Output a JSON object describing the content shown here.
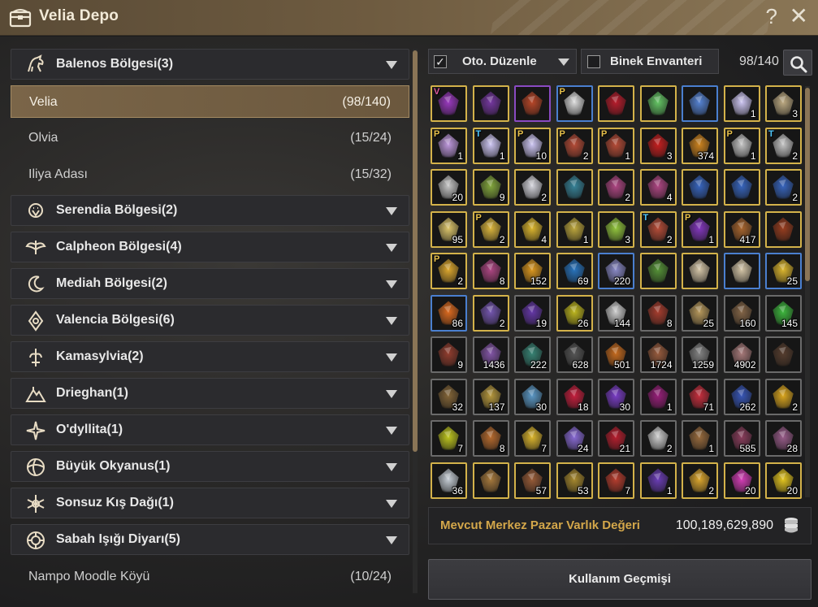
{
  "window": {
    "title": "Velia Depo",
    "help_label": "?",
    "close_label": "✕"
  },
  "regions": [
    {
      "label": "Balenos Bölgesi(3)",
      "icon": "horse-icon",
      "expanded": true
    },
    {
      "label": "Serendia Bölgesi(2)",
      "icon": "lion-icon"
    },
    {
      "label": "Calpheon Bölgesi(4)",
      "icon": "eagle-icon"
    },
    {
      "label": "Mediah Bölgesi(2)",
      "icon": "moon-icon"
    },
    {
      "label": "Valencia Bölgesi(6)",
      "icon": "sun-diamond-icon"
    },
    {
      "label": "Kamasylvia(2)",
      "icon": "tree-spirit-icon"
    },
    {
      "label": "Drieghan(1)",
      "icon": "mountain-icon"
    },
    {
      "label": "O'dyllita(1)",
      "icon": "star-icon"
    },
    {
      "label": "Büyük Okyanus(1)",
      "icon": "globe-icon"
    },
    {
      "label": "Sonsuz Kış Dağı(1)",
      "icon": "snowflake-icon"
    },
    {
      "label": "Sabah Işığı Diyarı(5)",
      "icon": "dawn-emblem-icon"
    }
  ],
  "towns": [
    {
      "name": "Velia",
      "count": "(98/140)",
      "selected": true
    },
    {
      "name": "Olvia",
      "count": "(15/24)"
    },
    {
      "name": "Iliya Adası",
      "count": "(15/32)"
    },
    {
      "name": "Nampo Moodle Köyü",
      "count": "(10/24)"
    }
  ],
  "toolbar": {
    "auto_sort_label": "Oto. Düzenle",
    "auto_sort_checked": true,
    "mount_inventory_label": "Binek Envanteri",
    "mount_inventory_checked": false,
    "capacity": "98/140",
    "check_mark": "✓"
  },
  "items": [
    {
      "q": "",
      "m": "V",
      "c": "g",
      "color": "#a23cc9",
      "icon": "pet-scroll-icon"
    },
    {
      "q": "",
      "m": "",
      "c": "g",
      "color": "#7b3aa8",
      "icon": "scroll-icon"
    },
    {
      "q": "",
      "m": "",
      "c": "p",
      "color": "#c24a2a",
      "icon": "ring-icon"
    },
    {
      "q": "",
      "m": "P",
      "c": "b",
      "color": "#e8e8e8",
      "icon": "wings-icon"
    },
    {
      "q": "",
      "m": "",
      "c": "g",
      "color": "#c21e2e",
      "icon": "crystal-shard-icon"
    },
    {
      "q": "",
      "m": "",
      "c": "g",
      "color": "#6ad06a",
      "icon": "green-crystal-icon"
    },
    {
      "q": "",
      "m": "",
      "c": "b",
      "color": "#5a8adf",
      "icon": "gun-icon"
    },
    {
      "q": "1",
      "m": "",
      "c": "g",
      "color": "#d8d0ff",
      "icon": "book-icon"
    },
    {
      "q": "3",
      "m": "",
      "c": "g",
      "color": "#c8b48a",
      "icon": "map-icon"
    },
    {
      "q": "1",
      "m": "P",
      "c": "g",
      "color": "#c8a0e8",
      "icon": "book-icon"
    },
    {
      "q": "1",
      "m": "T",
      "c": "g",
      "color": "#d8d0ff",
      "icon": "book-icon"
    },
    {
      "q": "10",
      "m": "P",
      "c": "g",
      "color": "#d8d0ff",
      "icon": "book-icon"
    },
    {
      "q": "2",
      "m": "P",
      "c": "g",
      "color": "#c0503a",
      "icon": "card-icon"
    },
    {
      "q": "1",
      "m": "P",
      "c": "g",
      "color": "#c0503a",
      "icon": "card-icon"
    },
    {
      "q": "3",
      "m": "",
      "c": "g",
      "color": "#d02020",
      "icon": "rose-icon"
    },
    {
      "q": "374",
      "m": "",
      "c": "g",
      "color": "#d88a20",
      "icon": "medal-icon"
    },
    {
      "q": "1",
      "m": "P",
      "c": "g",
      "color": "#d0d0d0",
      "icon": "white-tree-icon"
    },
    {
      "q": "2",
      "m": "T",
      "c": "g",
      "color": "#d0d0d0",
      "icon": "white-tree-icon"
    },
    {
      "q": "20",
      "m": "",
      "c": "g",
      "color": "#d0d0d0",
      "icon": "white-tree-icon"
    },
    {
      "q": "9",
      "m": "",
      "c": "g",
      "color": "#8ab040",
      "icon": "potion-icon"
    },
    {
      "q": "2",
      "m": "",
      "c": "g",
      "color": "#e0e0e8",
      "icon": "silver-chest-icon"
    },
    {
      "q": "",
      "m": "",
      "c": "g",
      "color": "#3a8aa0",
      "icon": "dark-stone-icon"
    },
    {
      "q": "2",
      "m": "",
      "c": "g",
      "color": "#b84a8a",
      "icon": "coupon-icon"
    },
    {
      "q": "4",
      "m": "",
      "c": "g",
      "color": "#b84a8a",
      "icon": "coupon-icon"
    },
    {
      "q": "",
      "m": "",
      "c": "g",
      "color": "#3a6ac8",
      "icon": "blue-chest-icon"
    },
    {
      "q": "",
      "m": "",
      "c": "g",
      "color": "#3a6ac8",
      "icon": "blue-chest-icon"
    },
    {
      "q": "2",
      "m": "",
      "c": "g",
      "color": "#3a6ac8",
      "icon": "blue-chest-icon"
    },
    {
      "q": "95",
      "m": "",
      "c": "g",
      "color": "#e8d070",
      "icon": "elixir-icon"
    },
    {
      "q": "2",
      "m": "P",
      "c": "g",
      "color": "#e8c040",
      "icon": "horn-icon"
    },
    {
      "q": "4",
      "m": "",
      "c": "g",
      "color": "#e8c030",
      "icon": "butterfly-icon"
    },
    {
      "q": "1",
      "m": "",
      "c": "g",
      "color": "#c8b040",
      "icon": "gold-card-icon"
    },
    {
      "q": "3",
      "m": "",
      "c": "g",
      "color": "#9ad040",
      "icon": "green-orb-icon"
    },
    {
      "q": "2",
      "m": "T",
      "c": "g",
      "color": "#c0503a",
      "icon": "card-icon"
    },
    {
      "q": "1",
      "m": "P",
      "c": "g",
      "color": "#8a3ac8",
      "icon": "purple-chest-icon"
    },
    {
      "q": "417",
      "m": "",
      "c": "g",
      "color": "#b06a30",
      "icon": "bottle-icon"
    },
    {
      "q": "",
      "m": "",
      "c": "g",
      "color": "#a04020",
      "icon": "lantern-icon"
    },
    {
      "q": "2",
      "m": "P",
      "c": "g",
      "color": "#e8b030",
      "icon": "sword-icon"
    },
    {
      "q": "8",
      "m": "",
      "c": "g",
      "color": "#b84a8a",
      "icon": "coupon-icon"
    },
    {
      "q": "152",
      "m": "",
      "c": "g",
      "color": "#e8a020",
      "icon": "gold-feather-icon"
    },
    {
      "q": "69",
      "m": "",
      "c": "g",
      "color": "#2a7ac8",
      "icon": "blue-ore-icon"
    },
    {
      "q": "220",
      "m": "",
      "c": "b",
      "color": "#9090d0",
      "icon": "silver-ore-icon"
    },
    {
      "q": "",
      "m": "",
      "c": "g",
      "color": "#5a9a3a",
      "icon": "herb-icon"
    },
    {
      "q": "",
      "m": "",
      "c": "g",
      "color": "#e0d0b0",
      "icon": "cake-icon"
    },
    {
      "q": "",
      "m": "",
      "c": "b",
      "color": "#e0d0b0",
      "icon": "cake-icon"
    },
    {
      "q": "25",
      "m": "",
      "c": "b",
      "color": "#e8c030",
      "icon": "oil-bottle-icon"
    },
    {
      "q": "86",
      "m": "",
      "c": "b",
      "color": "#e87020",
      "icon": "carrot-icon"
    },
    {
      "q": "2",
      "m": "",
      "c": "g",
      "color": "#7a5ab8",
      "icon": "purple-shard-icon"
    },
    {
      "q": "19",
      "m": "",
      "c": "n",
      "color": "#6a3ab0",
      "icon": "dark-crystal-icon"
    },
    {
      "q": "26",
      "m": "",
      "c": "g",
      "color": "#c8c020",
      "icon": "gold-ring-icon"
    },
    {
      "q": "144",
      "m": "",
      "c": "n",
      "color": "#d8d8d8",
      "icon": "silver-plate-icon"
    },
    {
      "q": "8",
      "m": "",
      "c": "n",
      "color": "#b04030",
      "icon": "log-icon"
    },
    {
      "q": "25",
      "m": "",
      "c": "n",
      "color": "#c0a060",
      "icon": "mushroom-icon"
    },
    {
      "q": "160",
      "m": "",
      "c": "n",
      "color": "#8a6a4a",
      "icon": "branch-icon"
    },
    {
      "q": "145",
      "m": "",
      "c": "n",
      "color": "#40c040",
      "icon": "leaf-icon"
    },
    {
      "q": "9",
      "m": "",
      "c": "n",
      "color": "#9a4030",
      "icon": "log-icon"
    },
    {
      "q": "1436",
      "m": "",
      "c": "n",
      "color": "#8a5ab0",
      "icon": "vial-icon"
    },
    {
      "q": "222",
      "m": "",
      "c": "n",
      "color": "#3a8a7a",
      "icon": "gem-icon"
    },
    {
      "q": "628",
      "m": "",
      "c": "n",
      "color": "#5a5a5a",
      "icon": "stone-pile-icon"
    },
    {
      "q": "501",
      "m": "",
      "c": "n",
      "color": "#d07020",
      "icon": "copper-pile-icon"
    },
    {
      "q": "1724",
      "m": "",
      "c": "n",
      "color": "#a06040",
      "icon": "plank-icon"
    },
    {
      "q": "1259",
      "m": "",
      "c": "n",
      "color": "#8a8a8a",
      "icon": "timber-icon"
    },
    {
      "q": "4902",
      "m": "",
      "c": "n",
      "color": "#b08080",
      "icon": "ingot-icon"
    },
    {
      "q": "",
      "m": "",
      "c": "n",
      "color": "#5a4030",
      "icon": "crate-icon"
    },
    {
      "q": "32",
      "m": "",
      "c": "n",
      "color": "#8a6a3a",
      "icon": "sack-icon"
    },
    {
      "q": "137",
      "m": "",
      "c": "n",
      "color": "#c0a040",
      "icon": "gem-cluster-icon"
    },
    {
      "q": "30",
      "m": "",
      "c": "n",
      "color": "#60a0d0",
      "icon": "spirit-orb-icon"
    },
    {
      "q": "18",
      "m": "",
      "c": "n",
      "color": "#d02040",
      "icon": "red-gem-icon"
    },
    {
      "q": "30",
      "m": "",
      "c": "n",
      "color": "#8040d0",
      "icon": "purple-gem-icon"
    },
    {
      "q": "1",
      "m": "",
      "c": "n",
      "color": "#a02080",
      "icon": "claw-icon"
    },
    {
      "q": "71",
      "m": "",
      "c": "n",
      "color": "#d03040",
      "icon": "ruby-icon"
    },
    {
      "q": "262",
      "m": "",
      "c": "n",
      "color": "#3a5ac0",
      "icon": "feather-icon"
    },
    {
      "q": "2",
      "m": "",
      "c": "n",
      "color": "#e8b020",
      "icon": "gold-stone-icon"
    },
    {
      "q": "7",
      "m": "",
      "c": "n",
      "color": "#c8d020",
      "icon": "flask-icon"
    },
    {
      "q": "8",
      "m": "",
      "c": "n",
      "color": "#c07030",
      "icon": "bomb-icon"
    },
    {
      "q": "7",
      "m": "",
      "c": "n",
      "color": "#e8c030",
      "icon": "gold-wing-icon"
    },
    {
      "q": "24",
      "m": "",
      "c": "n",
      "color": "#9070e0",
      "icon": "rune-icon"
    },
    {
      "q": "21",
      "m": "",
      "c": "n",
      "color": "#c02030",
      "icon": "red-feather-icon"
    },
    {
      "q": "2",
      "m": "",
      "c": "n",
      "color": "#d8d8d8",
      "icon": "vase-icon"
    },
    {
      "q": "1",
      "m": "",
      "c": "n",
      "color": "#a07040",
      "icon": "root-icon"
    },
    {
      "q": "585",
      "m": "",
      "c": "n",
      "color": "#904060",
      "icon": "dark-ore-icon"
    },
    {
      "q": "28",
      "m": "",
      "c": "n",
      "color": "#a06090",
      "icon": "shell-icon"
    },
    {
      "q": "36",
      "m": "",
      "c": "g",
      "color": "#d0d8e0",
      "icon": "salt-icon"
    },
    {
      "q": "",
      "m": "",
      "c": "g",
      "color": "#b08040",
      "icon": "axe-icon"
    },
    {
      "q": "57",
      "m": "",
      "c": "g",
      "color": "#a0603a",
      "icon": "coin-icon"
    },
    {
      "q": "53",
      "m": "",
      "c": "g",
      "color": "#b09030",
      "icon": "spear-icon"
    },
    {
      "q": "7",
      "m": "",
      "c": "g",
      "color": "#c04030",
      "icon": "hammer-icon"
    },
    {
      "q": "1",
      "m": "",
      "c": "g",
      "color": "#7040c0",
      "icon": "bowl-icon"
    },
    {
      "q": "2",
      "m": "",
      "c": "g",
      "color": "#e8b030",
      "icon": "amber-icon"
    },
    {
      "q": "20",
      "m": "",
      "c": "g",
      "color": "#e040c0",
      "icon": "pink-gem-icon"
    },
    {
      "q": "20",
      "m": "",
      "c": "g",
      "color": "#f0d020",
      "icon": "gold-orb-icon"
    }
  ],
  "value": {
    "label": "Mevcut Merkez Pazar Varlık Değeri",
    "amount": "100,189,629,890"
  },
  "history_button": "Kullanım Geçmişi"
}
